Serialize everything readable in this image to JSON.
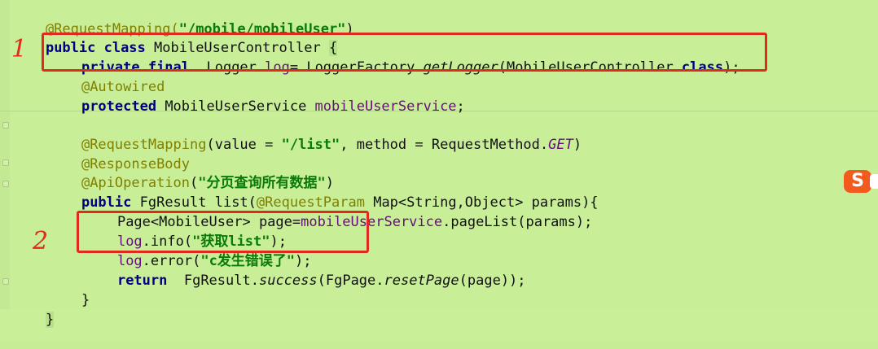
{
  "code": {
    "line1_annotation": "@RequestMapping(",
    "line1_string": "\"/mobile/mobileUser\"",
    "line1_close": ")",
    "line2_kw": "public class",
    "line2_rest": " MobileUserController ",
    "line2_brace": "{",
    "line3_kw": "private final",
    "line3_type": "  Logger ",
    "line3_field": "log",
    "line3_assign": "= LoggerFactory.",
    "line3_method": "getLogger",
    "line3_arg_open": "(MobileUserController.",
    "line3_kw2": "class",
    "line3_end": ");",
    "line4_annotation": "@Autowired",
    "line5_kw": "protected",
    "line5_type": " MobileUserService ",
    "line5_field": "mobileUserService",
    "line5_end": ";",
    "line6_annotation": "@RequestMapping",
    "line6_mid": "(value = ",
    "line6_string": "\"/list\"",
    "line6_mid2": ", method = RequestMethod.",
    "line6_const": "GET",
    "line6_end": ")",
    "line7_annotation": "@ResponseBody",
    "line8_annotation": "@ApiOperation",
    "line8_open": "(",
    "line8_string": "\"分页查询所有数据\"",
    "line8_end": ")",
    "line9_kw": "public",
    "line9_mid": " FgResult list(",
    "line9_annotation": "@RequestParam",
    "line9_end": " Map<String,Object> params){",
    "line10_start": "Page<MobileUser> page=",
    "line10_field": "mobileUserService",
    "line10_end": ".pageList(params);",
    "line11_field": "log",
    "line11_mid": ".info(",
    "line11_string": "\"获取list\"",
    "line11_end": ");",
    "line12_field": "log",
    "line12_mid": ".error(",
    "line12_string": "\"c发生错误了\"",
    "line12_end": ");",
    "line13_kw": "return",
    "line13_mid": "  FgResult.",
    "line13_method": "success",
    "line13_mid2": "(FgPage.",
    "line13_method2": "resetPage",
    "line13_end": "(page));",
    "line14": "}",
    "line15": "}"
  },
  "annotations": {
    "marker_1": "1",
    "marker_2": "2",
    "box_color": "#e0291f"
  },
  "overlay": {
    "sogou_icon_label": "S",
    "sogou_color": "#f25a1e"
  },
  "colors": {
    "background": "#c8ee98",
    "annotation": "#808000",
    "keyword": "#000080",
    "string": "#0a7a0a",
    "field": "#660e7a"
  }
}
